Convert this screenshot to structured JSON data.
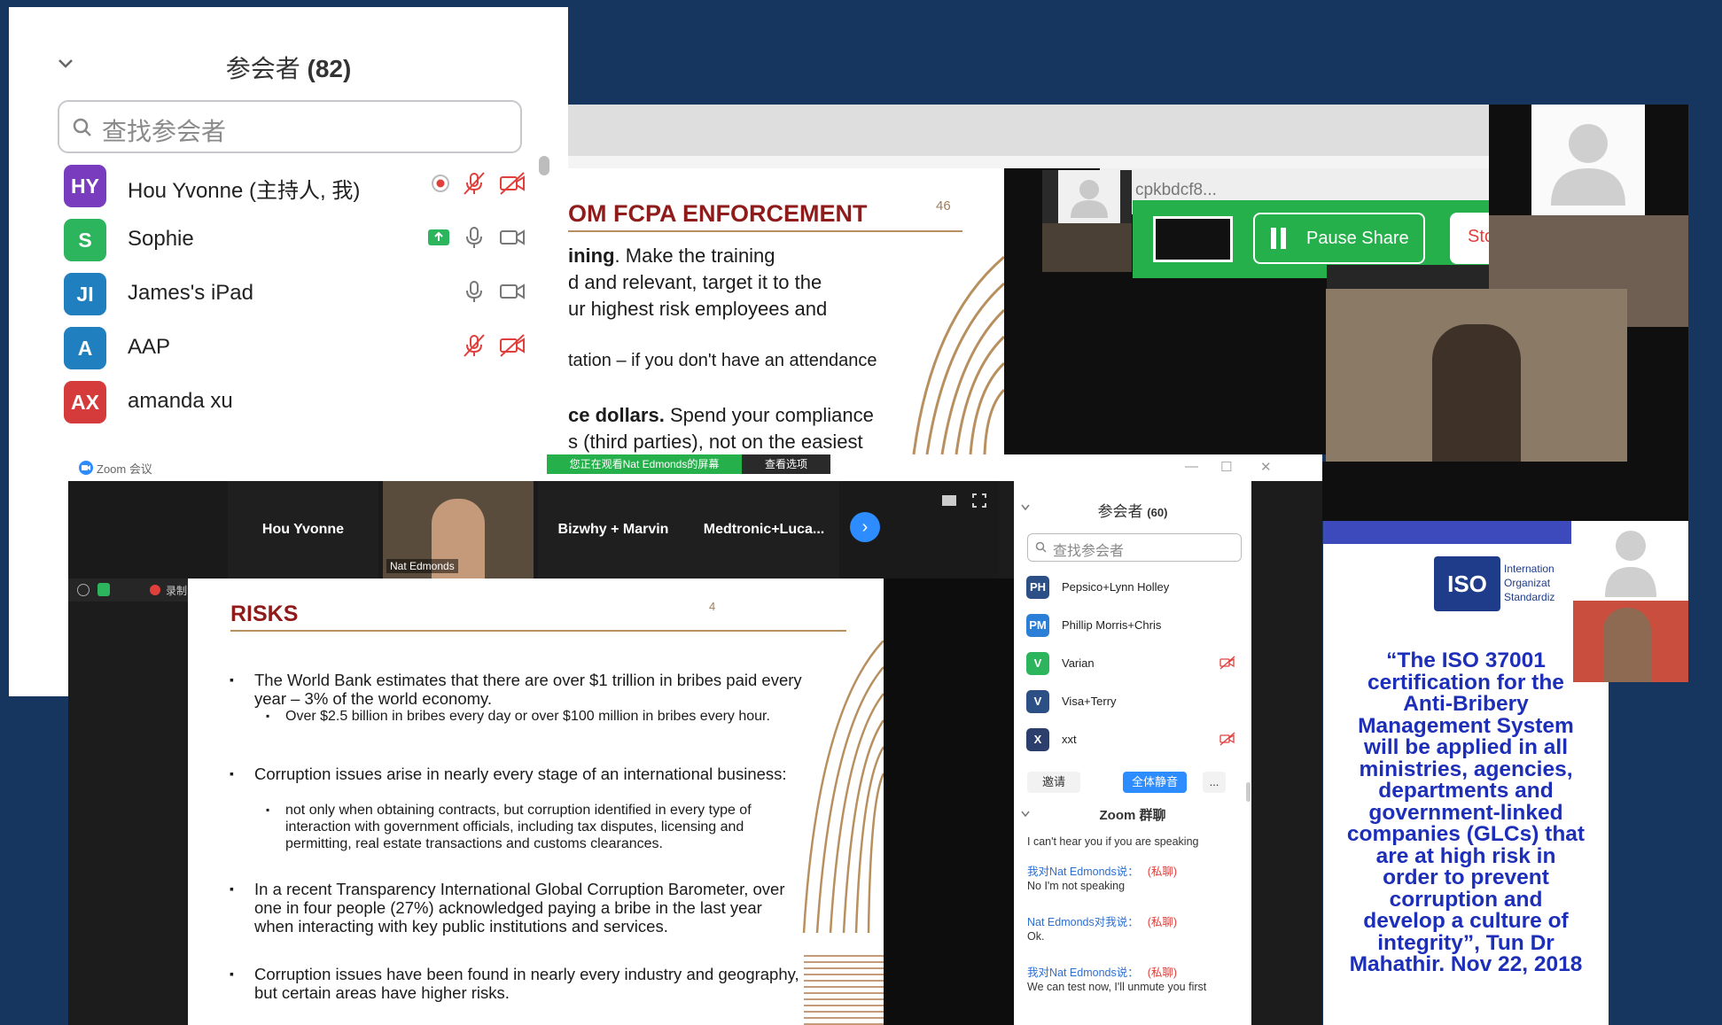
{
  "participants_big": {
    "title": "参会者",
    "count": "(82)",
    "search_placeholder": "查找参会者",
    "rows": [
      {
        "initials": "HY",
        "name": "Hou Yvonne (主持人, 我)",
        "color": "#7a3cbf"
      },
      {
        "initials": "S",
        "name": "Sophie",
        "color": "#2db55d"
      },
      {
        "initials": "JI",
        "name": "James's iPad",
        "color": "#1f7fbf"
      },
      {
        "initials": "A",
        "name": "AAP",
        "color": "#1f7fbf"
      },
      {
        "initials": "AX",
        "name": "amanda xu",
        "color": "#d63b3b"
      }
    ]
  },
  "top_slide": {
    "title": "OM FCPA ENFORCEMENT",
    "page_number": "46",
    "line1_bold": "ining",
    "line1_rest": ". Make the training",
    "line2": "d and relevant, target it to the",
    "line3": "ur highest risk employees and",
    "line4": "tation – if you don't have an attendance",
    "line5_bold": "ce dollars.",
    "line5_rest": " Spend your compliance",
    "line6": "s (third parties), not on the easiest"
  },
  "browser": {
    "url_fragment": "cpkbdcf8...",
    "pause_label": "Pause Share",
    "stop_label": "Stop"
  },
  "main_window": {
    "title": "Zoom 会议",
    "sharing_banner": "您正在观看Nat Edmonds的屏幕",
    "view_options": "查看选项",
    "recording_label": "录制中...",
    "tiles": [
      {
        "name": "Hou Yvonne"
      },
      {
        "name": "Nat Edmonds"
      },
      {
        "name": "Bizwhy + Marvin"
      },
      {
        "name": "Medtronic+Luca..."
      }
    ]
  },
  "risks_slide": {
    "title": "RISKS",
    "page_number": "4",
    "b1": "The World Bank estimates that there are over $1 trillion in bribes paid every year – 3% of the world economy.",
    "b1s": "Over $2.5 billion in bribes every day or over $100 million in bribes every hour.",
    "b2": "Corruption issues arise in nearly every stage of an international business:",
    "b2s": "not only when obtaining contracts, but corruption identified in every type of interaction with government officials, including tax disputes, licensing and permitting, real estate transactions and customs clearances.",
    "b3": "In a recent Transparency International Global Corruption Barometer, over one in four people (27%) acknowledged paying a bribe in the last year when interacting with key public institutions and services.",
    "b4": "Corruption issues have been found in nearly every industry and geography, but certain areas have higher risks."
  },
  "participants_small": {
    "title": "参会者",
    "count": "(60)",
    "search_placeholder": "查找参会者",
    "rows": [
      {
        "initials": "PH",
        "name": "Pepsico+Lynn Holley",
        "color": "#2c4f86"
      },
      {
        "initials": "PM",
        "name": "Phillip Morris+Chris",
        "color": "#2c7fd6"
      },
      {
        "initials": "V",
        "name": "Varian",
        "color": "#2db55d"
      },
      {
        "initials": "V",
        "name": "Visa+Terry",
        "color": "#2c4f86"
      },
      {
        "initials": "X",
        "name": "xxt",
        "color": "#2c3e6b"
      }
    ],
    "invite_label": "邀请",
    "mute_all_label": "全体静音",
    "more_label": "..."
  },
  "chat": {
    "title": "Zoom 群聊",
    "messages": [
      {
        "from": "",
        "text": "I can't hear you if you are speaking"
      },
      {
        "from": "我对Nat Edmonds说：",
        "private": "(私聊)",
        "text": "No I'm not speaking"
      },
      {
        "from": "Nat Edmonds对我说：",
        "private": "(私聊)",
        "text": "Ok."
      },
      {
        "from": "我对Nat Edmonds说：",
        "private": "(私聊)",
        "text": "We can test now, I'll unmute you first"
      }
    ]
  },
  "iso_slide": {
    "logo_text": "ISO",
    "org_lines": [
      "Internation",
      "Organizat",
      "Standardiz"
    ],
    "quote_lines": [
      "“The ISO 37001",
      "certification for the",
      "Anti-Bribery",
      "Management System",
      "will be applied in all",
      "ministries, agencies,",
      "departments and",
      "government-linked",
      "companies (GLCs) that",
      "are at high risk in",
      "order to prevent",
      "corruption and",
      "develop a culture of",
      "integrity”, Tun Dr",
      "Mahathir. Nov 22, 2018"
    ]
  }
}
